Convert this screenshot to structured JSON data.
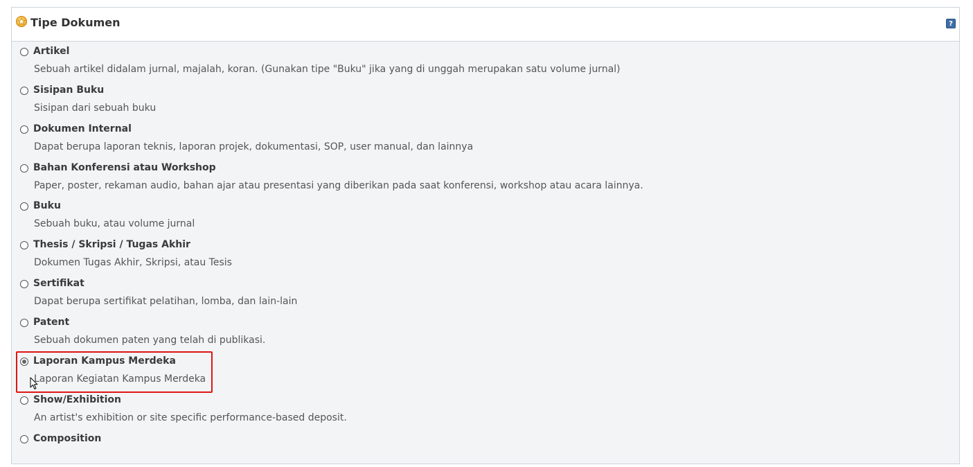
{
  "panel": {
    "title": "Tipe Dokumen",
    "title_icon": "star-icon",
    "help_icon": "help-icon",
    "help_label": "?"
  },
  "options": [
    {
      "label": "Artikel",
      "desc": "Sebuah artikel didalam jurnal, majalah, koran. (Gunakan tipe \"Buku\" jika yang di unggah merupakan satu volume jurnal)",
      "checked": false
    },
    {
      "label": "Sisipan Buku",
      "desc": "Sisipan dari sebuah buku",
      "checked": false
    },
    {
      "label": "Dokumen Internal",
      "desc": "Dapat berupa laporan teknis, laporan projek, dokumentasi, SOP, user manual, dan lainnya",
      "checked": false
    },
    {
      "label": "Bahan Konferensi atau Workshop",
      "desc": "Paper, poster, rekaman audio, bahan ajar atau presentasi yang diberikan pada saat konferensi, workshop atau acara lainnya.",
      "checked": false
    },
    {
      "label": "Buku",
      "desc": "Sebuah buku, atau volume jurnal",
      "checked": false
    },
    {
      "label": "Thesis / Skripsi / Tugas Akhir",
      "desc": "Dokumen Tugas Akhir, Skripsi, atau Tesis",
      "checked": false
    },
    {
      "label": "Sertifikat",
      "desc": "Dapat berupa sertifikat pelatihan, lomba, dan lain-lain",
      "checked": false
    },
    {
      "label": "Patent",
      "desc": "Sebuah dokumen paten yang telah di publikasi.",
      "checked": false
    },
    {
      "label": "Laporan Kampus Merdeka",
      "desc": "Laporan Kegiatan Kampus Merdeka",
      "checked": true
    },
    {
      "label": "Show/Exhibition",
      "desc": "An artist's exhibition or site specific performance-based deposit.",
      "checked": false
    },
    {
      "label": "Composition",
      "desc": "",
      "checked": false
    }
  ],
  "highlight_color": "#e01414"
}
